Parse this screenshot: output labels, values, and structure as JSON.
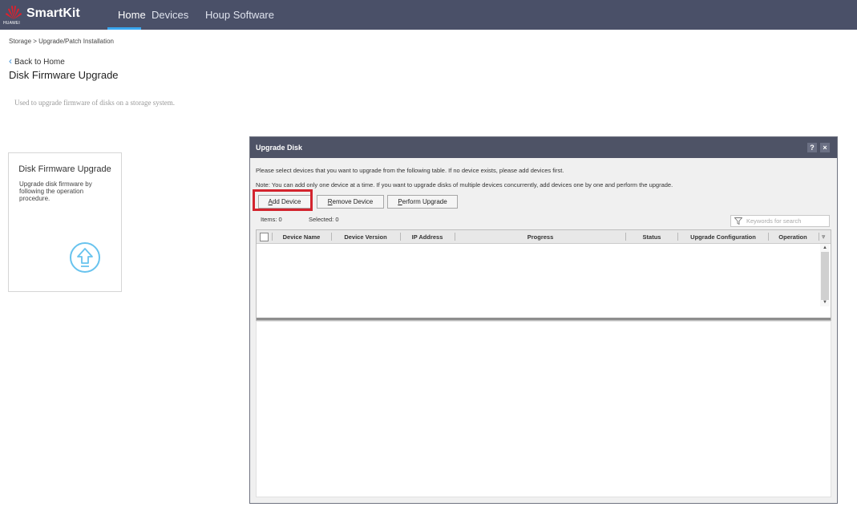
{
  "topbar": {
    "logo_text": "HUAWEI",
    "brand": "SmartKit",
    "nav": [
      "Home",
      "Devices",
      "Houp Software"
    ],
    "active": "Home"
  },
  "breadcrumb": "Storage > Upgrade/Patch Installation",
  "back_label": "Back to Home",
  "page_title": "Disk Firmware Upgrade",
  "description": "Used to upgrade firmware of disks on a storage system.",
  "card": {
    "title": "Disk Firmware Upgrade",
    "desc": "Upgrade disk firmware by following the operation procedure.",
    "icon": "upload-arrow-icon"
  },
  "dialog": {
    "title": "Upgrade Disk",
    "help": "?",
    "close": "×",
    "line1": "Please select devices that you want to upgrade from the following table. If no device exists, please add devices first.",
    "line2": "Note: You can add only one device at a time. If you want to upgrade disks of multiple devices concurrently, add devices one by one and perform the upgrade.",
    "buttons": {
      "add": {
        "accel": "A",
        "rest": "dd Device"
      },
      "remove": {
        "accel": "R",
        "rest": "emove Device"
      },
      "perform": {
        "accel": "P",
        "rest": "erform Upgrade"
      }
    },
    "items": "Items: 0",
    "selected": "Selected: 0",
    "search_placeholder": "Keywords for search",
    "columns": [
      "Device Name",
      "Device Version",
      "IP Address",
      "Progress",
      "Status",
      "Upgrade Configuration",
      "Operation"
    ],
    "highlight_color": "#d3242e"
  }
}
